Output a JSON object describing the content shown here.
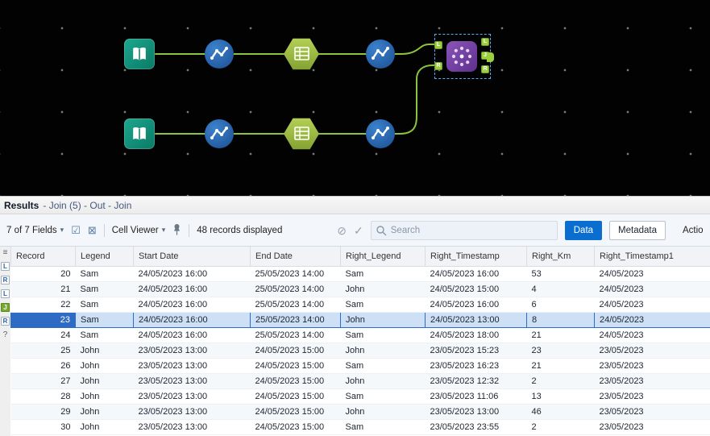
{
  "canvas": {
    "connection_color": "#8bc53f",
    "join": {
      "left_anchors": [
        "L",
        "R"
      ],
      "right_anchors": [
        "L",
        "J",
        "R"
      ]
    }
  },
  "results": {
    "title": "Results",
    "path": "- Join (5) - Out - Join",
    "toolbar": {
      "fields_label": "7 of 7 Fields",
      "cell_viewer_label": "Cell Viewer",
      "records_displayed": "48 records displayed",
      "search_placeholder": "Search",
      "data_label": "Data",
      "metadata_label": "Metadata",
      "actions_label": "Actions"
    },
    "side_strip": {
      "items": [
        "≡",
        "L",
        "R",
        "L",
        "J",
        "R",
        "?"
      ],
      "active_index": 4
    },
    "table": {
      "columns": [
        "Record",
        "Legend",
        "Start Date",
        "End Date",
        "Right_Legend",
        "Right_Timestamp",
        "Right_Km",
        "Right_Timestamp1"
      ],
      "selected_record": "23",
      "rows": [
        [
          "20",
          "Sam",
          "24/05/2023 16:00",
          "25/05/2023 14:00",
          "Sam",
          "24/05/2023 16:00",
          "53",
          "24/05/2023"
        ],
        [
          "21",
          "Sam",
          "24/05/2023 16:00",
          "25/05/2023 14:00",
          "John",
          "24/05/2023 15:00",
          "4",
          "24/05/2023"
        ],
        [
          "22",
          "Sam",
          "24/05/2023 16:00",
          "25/05/2023 14:00",
          "Sam",
          "24/05/2023 16:00",
          "6",
          "24/05/2023"
        ],
        [
          "23",
          "Sam",
          "24/05/2023 16:00",
          "25/05/2023 14:00",
          "John",
          "24/05/2023 13:00",
          "8",
          "24/05/2023"
        ],
        [
          "24",
          "Sam",
          "24/05/2023 16:00",
          "25/05/2023 14:00",
          "Sam",
          "24/05/2023 18:00",
          "21",
          "24/05/2023"
        ],
        [
          "25",
          "John",
          "23/05/2023 13:00",
          "24/05/2023 15:00",
          "John",
          "23/05/2023 15:23",
          "23",
          "23/05/2023"
        ],
        [
          "26",
          "John",
          "23/05/2023 13:00",
          "24/05/2023 15:00",
          "Sam",
          "23/05/2023 16:23",
          "21",
          "23/05/2023"
        ],
        [
          "27",
          "John",
          "23/05/2023 13:00",
          "24/05/2023 15:00",
          "John",
          "23/05/2023 12:32",
          "2",
          "23/05/2023"
        ],
        [
          "28",
          "John",
          "23/05/2023 13:00",
          "24/05/2023 15:00",
          "Sam",
          "23/05/2023 11:06",
          "13",
          "23/05/2023"
        ],
        [
          "29",
          "John",
          "23/05/2023 13:00",
          "24/05/2023 15:00",
          "John",
          "23/05/2023 13:00",
          "46",
          "23/05/2023"
        ],
        [
          "30",
          "John",
          "23/05/2023 13:00",
          "24/05/2023 15:00",
          "Sam",
          "23/05/2023 23:55",
          "2",
          "23/05/2023"
        ]
      ]
    }
  },
  "colors": {
    "accent_blue": "#0a6ed1",
    "selection_blue": "#2e6bc4",
    "connection_green": "#8bc53f",
    "tool_teal": "#0f8a78",
    "tool_blue": "#2f74c0",
    "tool_green": "#9ab83f",
    "tool_purple": "#7a3fa8"
  }
}
